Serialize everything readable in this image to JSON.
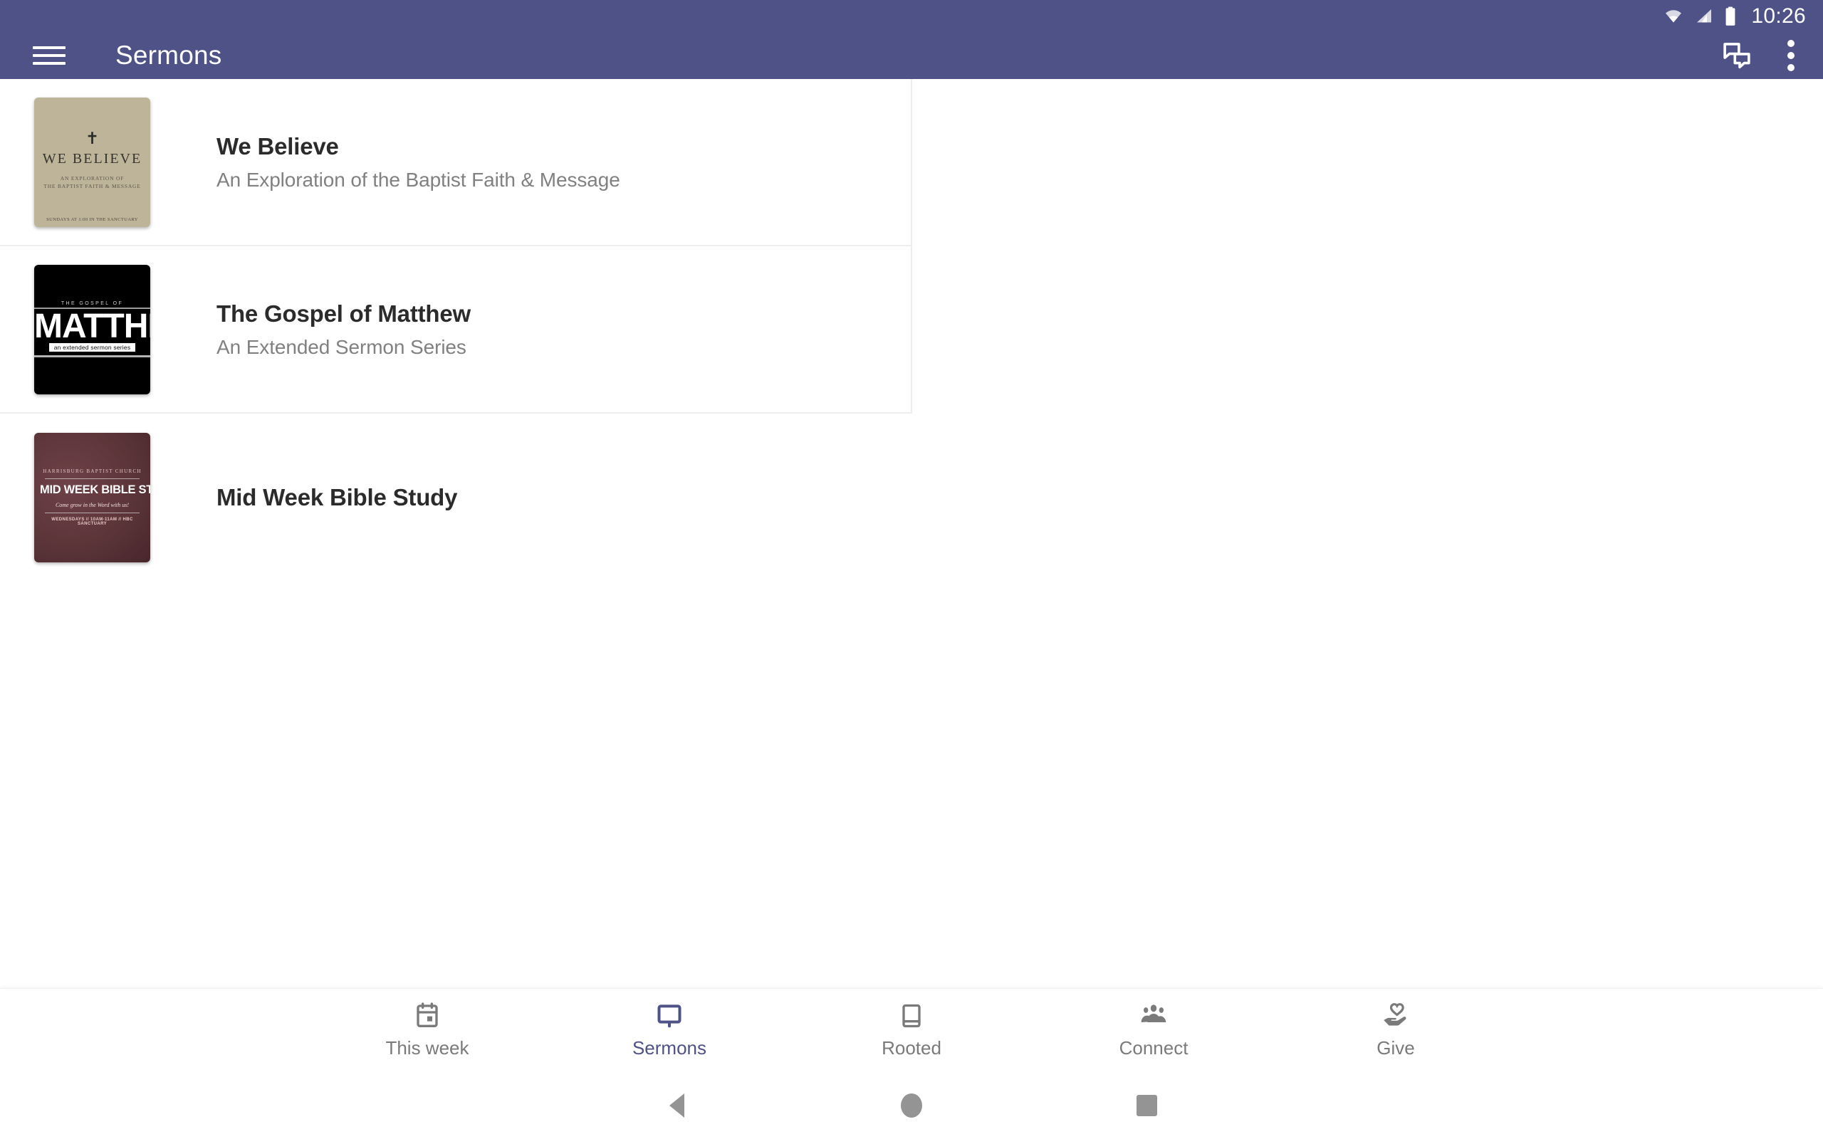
{
  "status_bar": {
    "time": "10:26",
    "icons": [
      "wifi-icon",
      "cellular-signal-icon",
      "battery-icon"
    ]
  },
  "app_bar": {
    "menu_icon": "hamburger-menu-icon",
    "title": "Sermons",
    "actions": [
      {
        "icon": "chat-bubbles-icon",
        "name": "messages-button"
      },
      {
        "icon": "overflow-menu-icon",
        "name": "overflow-menu-button"
      }
    ],
    "background_color": "#4F5286"
  },
  "sermon_series": [
    {
      "title": "We Believe",
      "subtitle": "An Exploration of the Baptist Faith & Message",
      "artwork": {
        "style": "believe",
        "cross": "✝",
        "title": "WE BELIEVE",
        "subtitle_line1": "AN EXPLORATION OF",
        "subtitle_line2": "THE BAPTIST FAITH & MESSAGE",
        "footer": "SUNDAYS AT 1:00 IN THE SANCTUARY",
        "background_color": "#beb49a"
      }
    },
    {
      "title": "Mid Week Bible Study",
      "subtitle": "",
      "artwork": {
        "style": "midweek",
        "church": "HARRISBURG BAPTIST CHURCH",
        "title": "MID WEEK BIBLE STUDY",
        "tagline": "Come grow in the Word with us!",
        "footer": "WEDNESDAYS // 10AM-11AM // HBC SANCTUARY",
        "background_color": "#5c3539"
      }
    },
    {
      "title": "The Gospel of Matthew",
      "subtitle": "An Extended Sermon Series",
      "artwork": {
        "style": "matthew",
        "kicker": "THE GOSPEL OF",
        "title": "MATTHEW",
        "badge": "an extended sermon series",
        "background_color": "#000000"
      }
    }
  ],
  "bottom_nav": {
    "active_color": "#4F5286",
    "inactive_color": "#7a7a7a",
    "items": [
      {
        "label": "This week",
        "icon": "calendar-icon",
        "active": false
      },
      {
        "label": "Sermons",
        "icon": "monitor-icon",
        "active": true
      },
      {
        "label": "Rooted",
        "icon": "book-icon",
        "active": false
      },
      {
        "label": "Connect",
        "icon": "people-group-icon",
        "active": false
      },
      {
        "label": "Give",
        "icon": "hand-heart-icon",
        "active": false
      }
    ]
  },
  "system_nav": {
    "back": "back-triangle-icon",
    "home": "home-circle-icon",
    "recents": "recents-square-icon"
  }
}
